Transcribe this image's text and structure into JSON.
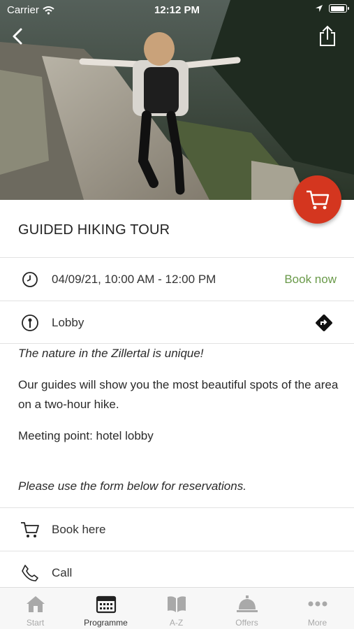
{
  "status_bar": {
    "carrier": "Carrier",
    "time": "12:12 PM"
  },
  "event": {
    "title": "GUIDED HIKING TOUR",
    "datetime": "04/09/21, 10:00 AM - 12:00 PM",
    "book_now_label": "Book now",
    "location": "Lobby"
  },
  "description": {
    "tagline": "The nature in the Zillertal is unique!",
    "paragraph": "Our guides will show you the most beautiful spots of the area on a two-hour hike.",
    "meeting_point": "Meeting point: hotel lobby",
    "note": "Please use the form below for reservations."
  },
  "actions": [
    {
      "label": "Book here",
      "icon": "cart-icon"
    },
    {
      "label": "Call",
      "icon": "phone-icon"
    }
  ],
  "tabbar": {
    "items": [
      {
        "label": "Start",
        "icon": "house-icon",
        "active": false
      },
      {
        "label": "Programme",
        "icon": "calendar-icon",
        "active": true
      },
      {
        "label": "A-Z",
        "icon": "book-icon",
        "active": false
      },
      {
        "label": "Offers",
        "icon": "service-bell-icon",
        "active": false
      },
      {
        "label": "More",
        "icon": "more-dots-icon",
        "active": false
      }
    ]
  },
  "colors": {
    "accent": "#d4361f",
    "book_now": "#6a9a4a",
    "tab_inactive": "#a9a9a9"
  }
}
